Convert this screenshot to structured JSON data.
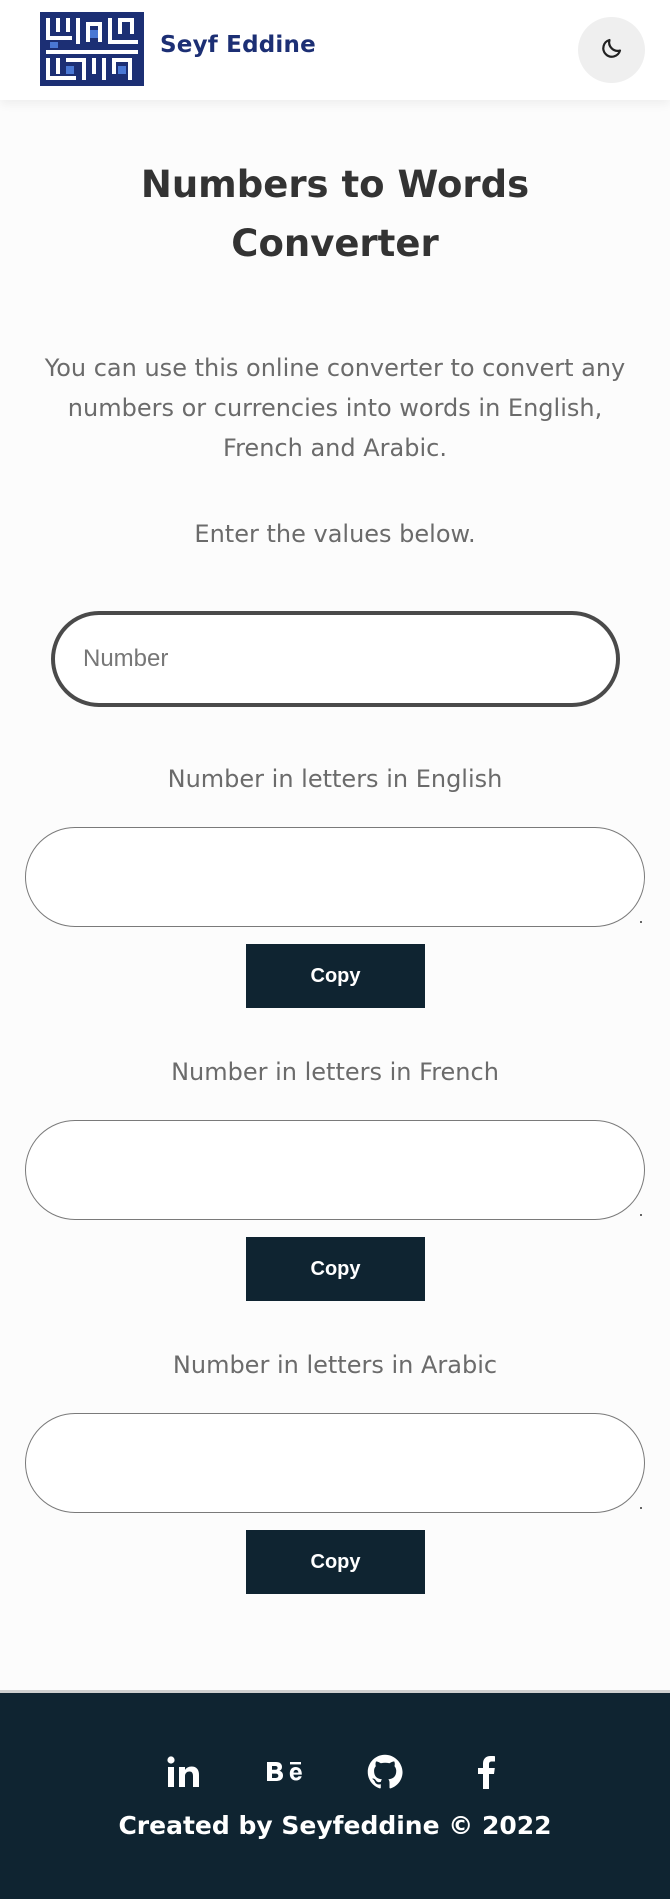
{
  "header": {
    "brand_name": "Seyf Eddine",
    "logo_icon": "seyf-eddine-logo",
    "theme_toggle_icon": "moon-icon"
  },
  "main": {
    "title_line1": "Numbers to Words",
    "title_line2": "Converter",
    "description": "You can use this online converter to convert any numbers or currencies into words in English, French and Arabic.",
    "instruction": "Enter the values below.",
    "number_input": {
      "placeholder": "Number",
      "value": ""
    }
  },
  "sections": [
    {
      "label": "Number in letters in English",
      "value": "",
      "copy_label": "Copy"
    },
    {
      "label": "Number in letters in French",
      "value": "",
      "copy_label": "Copy"
    },
    {
      "label": "Number in letters in Arabic",
      "value": "",
      "copy_label": "Copy"
    }
  ],
  "footer": {
    "social_icons": [
      "linkedin-icon",
      "behance-icon",
      "github-icon",
      "facebook-icon"
    ],
    "credit": "Created by Seyfeddine © 2022"
  },
  "colors": {
    "brand_blue": "#1c2f74",
    "logo_accent": "#4a78d4",
    "dark_navy": "#0f2431",
    "background": "#fcfcfc",
    "text_muted": "#6b6b6b"
  }
}
